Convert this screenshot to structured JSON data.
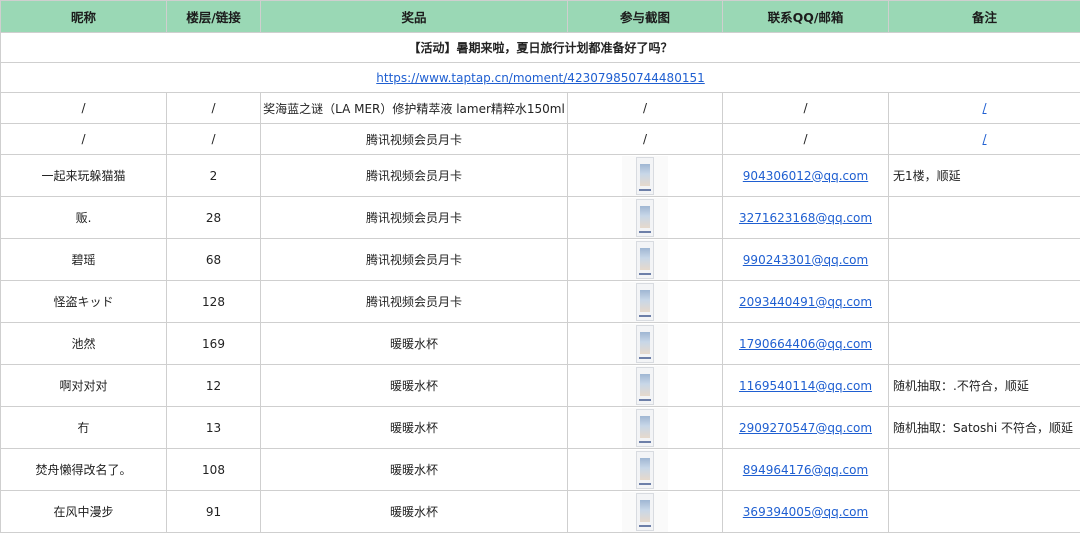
{
  "headers": [
    "昵称",
    "楼层/链接",
    "奖品",
    "参与截图",
    "联系QQ/邮箱",
    "备注"
  ],
  "activity_title": "【活动】暑期来啦，夏日旅行计划都准备好了吗？",
  "activity_link": "https://www.taptap.cn/moment/423079850744480151",
  "top_rows": [
    {
      "nickname": "/",
      "floor": "/",
      "prize": "奖海蓝之谜（LA MER）修护精萃液 lamer精粹水150ml",
      "screenshot": "/",
      "contact": "/",
      "note": "/"
    },
    {
      "nickname": "/",
      "floor": "/",
      "prize": "腾讯视频会员月卡",
      "screenshot": "/",
      "contact": "/",
      "note": "/"
    }
  ],
  "rows": [
    {
      "nickname": "一起来玩躲猫猫",
      "floor": "2",
      "prize": "腾讯视频会员月卡",
      "contact": "904306012@qq.com",
      "note": "无1楼，顺延"
    },
    {
      "nickname": "贩.",
      "floor": "28",
      "prize": "腾讯视频会员月卡",
      "contact": "3271623168@qq.com",
      "note": ""
    },
    {
      "nickname": "碧瑶",
      "floor": "68",
      "prize": "腾讯视频会员月卡",
      "contact": "990243301@qq.com",
      "note": ""
    },
    {
      "nickname": "怪盗キッド",
      "floor": "128",
      "prize": "腾讯视频会员月卡",
      "contact": "2093440491@qq.com",
      "note": ""
    },
    {
      "nickname": "池然",
      "floor": "169",
      "prize": "暖暖水杯",
      "contact": "1790664406@qq.com",
      "note": ""
    },
    {
      "nickname": "啊对对对",
      "floor": "12",
      "prize": "暖暖水杯",
      "contact": "1169540114@qq.com",
      "note": "随机抽取：.不符合，顺延"
    },
    {
      "nickname": "冇",
      "floor": "13",
      "prize": "暖暖水杯",
      "contact": "2909270547@qq.com",
      "note": "随机抽取：Satoshi 不符合，顺延"
    },
    {
      "nickname": "焚舟懒得改名了。",
      "floor": "108",
      "prize": "暖暖水杯",
      "contact": "894964176@qq.com",
      "note": ""
    },
    {
      "nickname": "在风中漫步",
      "floor": "91",
      "prize": "暖暖水杯",
      "contact": "369394005@qq.com",
      "note": ""
    }
  ]
}
